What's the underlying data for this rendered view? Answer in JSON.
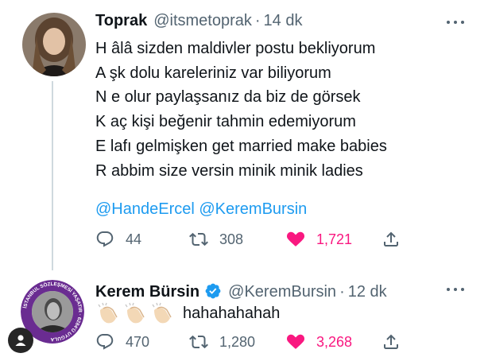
{
  "tweet1": {
    "name": "Toprak",
    "handle": "@itsmetoprak",
    "separator": "·",
    "time": "14 dk",
    "lines": [
      "H âlâ sizden maldivler postu bekliyorum",
      "A şk dolu kareleriniz var biliyorum",
      "N e olur paylaşsanız da biz de görsek",
      "K aç kişi beğenir tahmin edemiyorum",
      "E lafı gelmişken get married make babies",
      "R abbim size versin minik minik ladies"
    ],
    "mentions": [
      "@HandeErcel",
      "@KeremBursin"
    ],
    "replies": "44",
    "retweets": "308",
    "likes": "1,721"
  },
  "tweet2": {
    "name": "Kerem Bürsin",
    "handle": "@KeremBursin",
    "separator": "·",
    "time": "12 dk",
    "text": "hahahahahah",
    "emojis": [
      "clapping-hands",
      "clapping-hands",
      "clapping-hands"
    ],
    "avatar_badge_text": "İSTANBUL SÖZLEŞMESİ YAŞATIR · 6284'Ü UYGULA",
    "replies": "470",
    "retweets": "1,280",
    "likes": "3,268"
  },
  "colors": {
    "text": "#0f1419",
    "secondary": "#536471",
    "link": "#1d9bf0",
    "like": "#f91880",
    "verified": "#1d9bf0",
    "thread_line": "#cfd9de",
    "badge_ring": "#6a2c91"
  },
  "icons": [
    "reply-icon",
    "retweet-icon",
    "heart-icon",
    "share-icon",
    "more-icon",
    "verified-icon",
    "profile-icon"
  ]
}
